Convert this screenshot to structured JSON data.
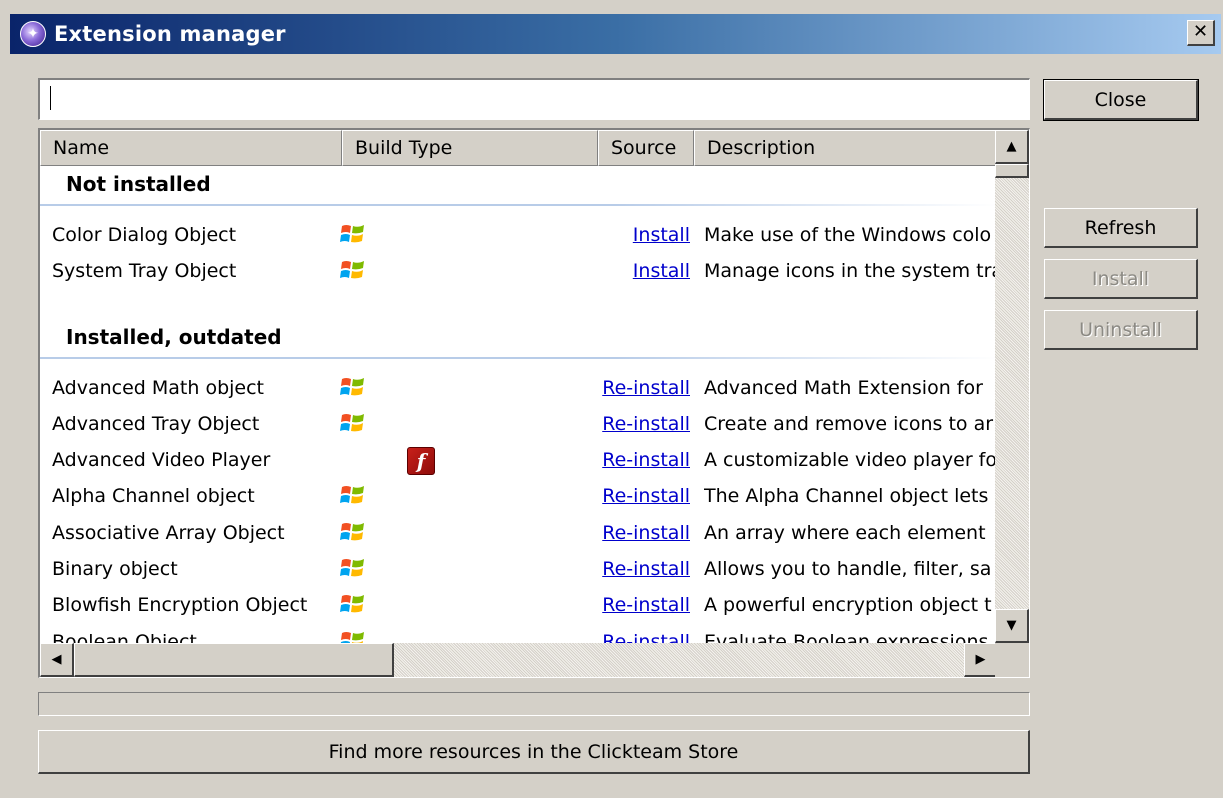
{
  "window": {
    "title": "Extension manager",
    "close_glyph": "✕"
  },
  "search": {
    "value": "",
    "placeholder": ""
  },
  "buttons": {
    "close": "Close",
    "refresh": "Refresh",
    "install": "Install",
    "uninstall": "Uninstall",
    "store": "Find more resources in the Clickteam Store"
  },
  "columns": [
    "Name",
    "Build Type",
    "Source",
    "Description"
  ],
  "groups": [
    {
      "title": "Not installed",
      "items": [
        {
          "name": "Color Dialog Object",
          "build_icon": "windows-icon",
          "action": "Install",
          "description": "Make use of the Windows colo"
        },
        {
          "name": "System Tray Object",
          "build_icon": "windows-icon",
          "action": "Install",
          "description": "Manage icons in the system tra"
        }
      ]
    },
    {
      "title": "Installed, outdated",
      "items": [
        {
          "name": "Advanced Math object",
          "build_icon": "windows-icon",
          "action": "Re-install",
          "description": "Advanced Math Extension for"
        },
        {
          "name": "Advanced Tray Object",
          "build_icon": "windows-icon",
          "action": "Re-install",
          "description": "Create and remove icons to ar"
        },
        {
          "name": "Advanced Video Player",
          "build_icon": "flash-icon",
          "action": "Re-install",
          "description": "A customizable video player fo"
        },
        {
          "name": "Alpha Channel object",
          "build_icon": "windows-icon",
          "action": "Re-install",
          "description": "The Alpha Channel object lets"
        },
        {
          "name": "Associative Array Object",
          "build_icon": "windows-icon",
          "action": "Re-install",
          "description": "An array where each element"
        },
        {
          "name": "Binary object",
          "build_icon": "windows-icon",
          "action": "Re-install",
          "description": "Allows you to handle, filter, sa"
        },
        {
          "name": "Blowfish Encryption Object",
          "build_icon": "windows-icon",
          "action": "Re-install",
          "description": "A powerful encryption object t"
        },
        {
          "name": "Boolean Object",
          "build_icon": "windows-icon",
          "action": "Re-install",
          "description": "Evaluate Boolean expressions"
        }
      ]
    }
  ],
  "icons": {
    "flash_glyph": "f"
  },
  "colors": {
    "link": "#0000cc",
    "title_start": "#0a246a",
    "title_end": "#a6caf0"
  }
}
